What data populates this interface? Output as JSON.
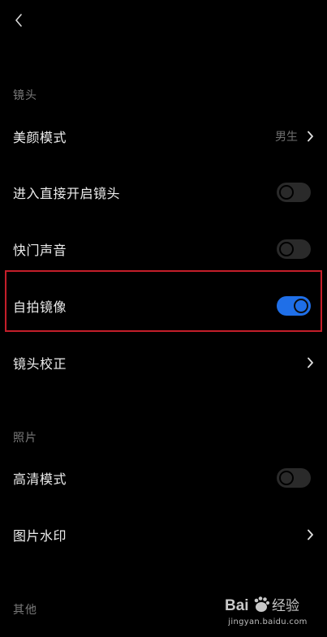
{
  "header": {
    "back_icon": "chevron-left-icon"
  },
  "sections": {
    "camera": {
      "header": "镜头",
      "beauty_mode": {
        "label": "美颜模式",
        "value": "男生"
      },
      "open_camera_on_enter": {
        "label": "进入直接开启镜头",
        "toggle": false
      },
      "shutter_sound": {
        "label": "快门声音",
        "toggle": false
      },
      "selfie_mirror": {
        "label": "自拍镜像",
        "toggle": true
      },
      "lens_correction": {
        "label": "镜头校正"
      }
    },
    "photo": {
      "header": "照片",
      "hd_mode": {
        "label": "高清模式",
        "toggle": false
      },
      "watermark": {
        "label": "图片水印"
      }
    },
    "other": {
      "header": "其他"
    }
  },
  "overlay": {
    "highlight_color": "#c41e2a",
    "watermark_brand": "Baidu经验",
    "watermark_url": "jingyan.baidu.com"
  },
  "colors": {
    "background": "#000000",
    "toggle_on": "#1f6fe8",
    "toggle_off": "#2a2a2a",
    "section_header": "#7a7a7a",
    "label": "#ededed"
  }
}
